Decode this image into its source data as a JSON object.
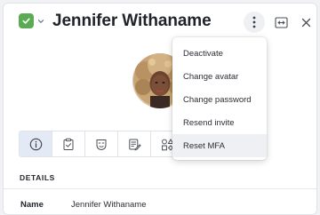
{
  "header": {
    "user_name": "Jennifer Withaname",
    "status_color": "#5aab53"
  },
  "tabs": [
    {
      "icon": "info-icon",
      "active": true
    },
    {
      "icon": "clipboard-check-icon",
      "active": false
    },
    {
      "icon": "mask-icon",
      "active": false
    },
    {
      "icon": "document-edit-icon",
      "active": false
    },
    {
      "icon": "shapes-icon",
      "active": false
    }
  ],
  "details": {
    "section_title": "DETAILS",
    "name_label": "Name",
    "name_value": "Jennifer Withaname"
  },
  "menu": {
    "items": [
      {
        "label": "Deactivate"
      },
      {
        "label": "Change avatar"
      },
      {
        "label": "Change password"
      },
      {
        "label": "Resend invite"
      },
      {
        "label": "Reset MFA"
      }
    ]
  }
}
